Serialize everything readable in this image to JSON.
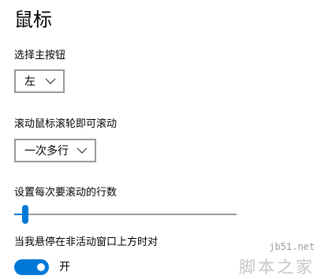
{
  "page": {
    "title": "鼠标"
  },
  "primary_button": {
    "label": "选择主按钮",
    "value": "左",
    "chevron_icon": "chevron-down-icon"
  },
  "wheel_scroll": {
    "label": "滚动鼠标滚轮即可滚动",
    "value": "一次多行",
    "chevron_icon": "chevron-down-icon"
  },
  "lines_to_scroll": {
    "label": "设置每次要滚动的行数",
    "slider_level": 0.035
  },
  "inactive_scroll": {
    "label": "当我悬停在非活动窗口上方时对",
    "toggle_state": "开",
    "is_on": true
  },
  "watermark": {
    "site": "jb51.net",
    "name": "脚本之家"
  },
  "colors": {
    "accent": "#0078d7",
    "border": "#999999",
    "text": "#000000",
    "background": "#ffffff"
  }
}
